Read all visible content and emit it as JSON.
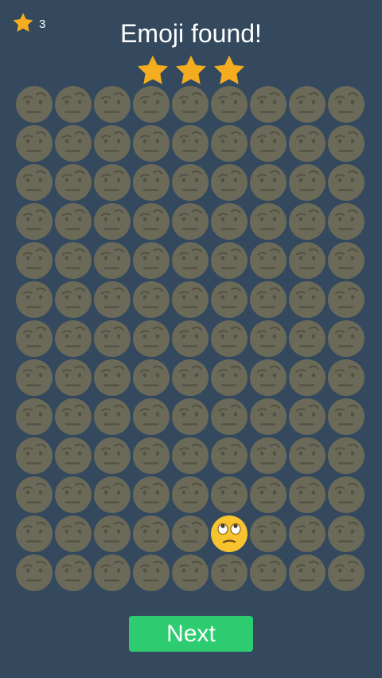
{
  "colors": {
    "background": "#34495e",
    "star": "#f4ad1f",
    "face_dim": "#6b6a58",
    "face_dim_feature": "#525144",
    "face_target": "#f7c32e",
    "button": "#2ecc71"
  },
  "score": {
    "icon": "star-icon",
    "value": "3"
  },
  "title": "Emoji found!",
  "rating": {
    "stars": 3,
    "max": 3
  },
  "grid": {
    "rows": 13,
    "cols": 9,
    "decoy_emoji": "face-with-raised-eyebrow-icon",
    "target_emoji": "face-with-rolling-eyes-icon",
    "target_row": 12,
    "target_col": 6
  },
  "next_button": {
    "label": "Next"
  }
}
